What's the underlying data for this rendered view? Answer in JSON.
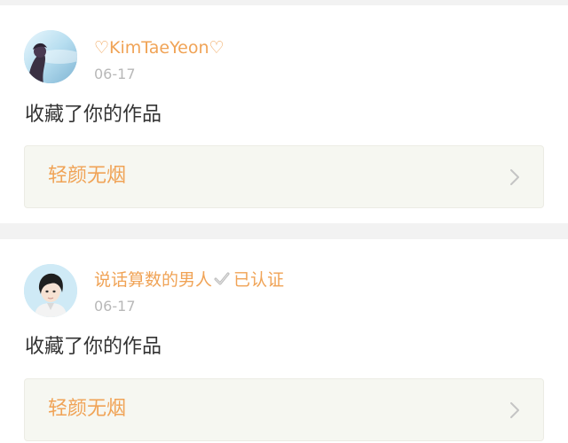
{
  "colors": {
    "name_orange": "#f0a356",
    "work_box_bg": "#f6f7f1",
    "chevron_gray": "#c4c4c4",
    "verified_check": "#b8b8b8"
  },
  "icons": {
    "chevron": "chevron-right-icon",
    "verified": "checkmark-icon"
  },
  "feed": {
    "items": [
      {
        "username": "♡KimTaeYeon♡",
        "timestamp": "06-17",
        "action": "收藏了你的作品",
        "work_title": "轻颜无烟"
      },
      {
        "username": "说话算数的男人",
        "verified_label": "已认证",
        "timestamp": "06-17",
        "action": "收藏了你的作品",
        "work_title": "轻颜无烟"
      }
    ]
  }
}
